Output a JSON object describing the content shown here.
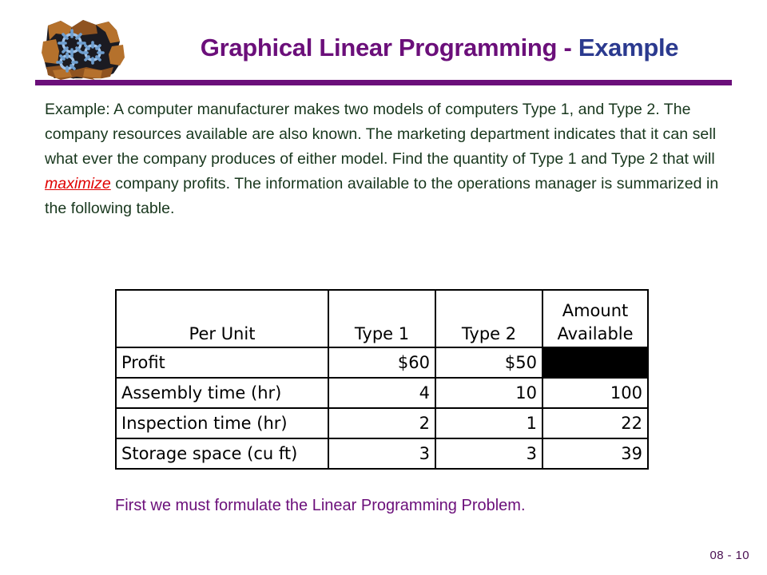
{
  "header": {
    "logo_icon": "gears-breaking-through-wall-icon",
    "title_main": "Graphical Linear Programming - ",
    "title_accent": "Example",
    "title_colors": {
      "main": "#6b0f7a",
      "accent": "#2b3a8f",
      "rule": "#6b0f7a"
    }
  },
  "body": {
    "paragraph_part1": "Example:  A computer manufacturer makes two models of computers Type 1, and Type 2.  The company resources available are also known.  The marketing department indicates that it can sell what ever the company produces of either model.  Find the quantity of Type 1 and Type 2 that will ",
    "paragraph_highlight": "maximize",
    "paragraph_part2": " company profits.  The information available to the operations manager is summarized in the following table.",
    "text_color": "#18371d",
    "highlight_color": "#e00000"
  },
  "table": {
    "headers": [
      "Per Unit",
      "Type 1",
      "Type 2",
      "Amount Available"
    ],
    "header_amount_line1": "Amount",
    "header_amount_line2": "Available",
    "rows": [
      {
        "label": "Profit",
        "type1": "$60",
        "type2": "$50",
        "amount": "",
        "amount_blacked_out": true
      },
      {
        "label": "Assembly time (hr)",
        "type1": "4",
        "type2": "10",
        "amount": "100",
        "amount_blacked_out": false
      },
      {
        "label": "Inspection time (hr)",
        "type1": "2",
        "type2": "1",
        "amount": "22",
        "amount_blacked_out": false
      },
      {
        "label": "Storage space (cu ft)",
        "type1": "3",
        "type2": "3",
        "amount": "39",
        "amount_blacked_out": false
      }
    ]
  },
  "footer": {
    "closing_note": "First we must formulate the Linear Programming Problem.",
    "closing_note_color": "#6b0f7a",
    "page_number": "08 - 10"
  }
}
